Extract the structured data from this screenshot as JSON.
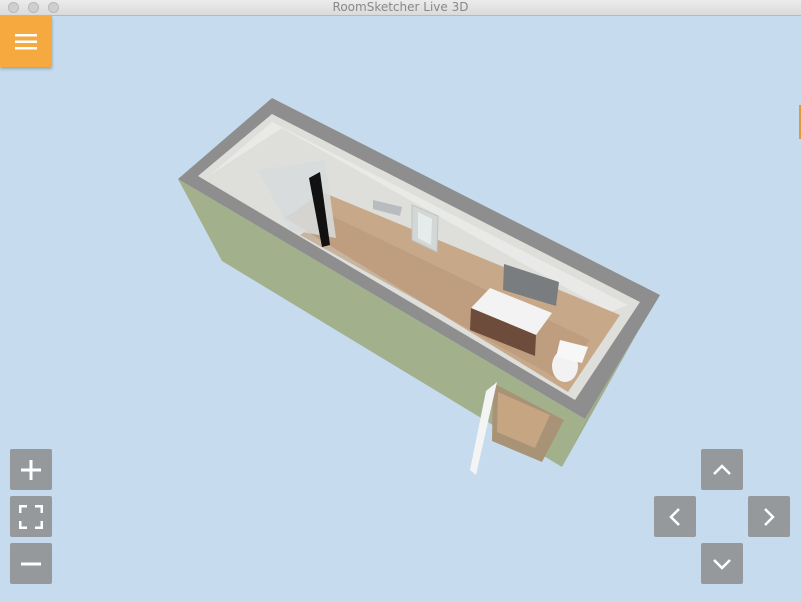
{
  "window": {
    "title": "RoomSketcher Live 3D"
  },
  "toolbar": {
    "menu_icon": "hamburger-menu-icon"
  },
  "zoom_controls": {
    "zoom_in_icon": "plus-icon",
    "fit_icon": "fullscreen-icon",
    "zoom_out_icon": "minus-icon"
  },
  "navigation": {
    "up_icon": "chevron-up-icon",
    "left_icon": "chevron-left-icon",
    "right_icon": "chevron-right-icon",
    "down_icon": "chevron-down-icon"
  },
  "colors": {
    "menu_button": "#f5a93e",
    "control_button": "#96999c",
    "background": "#c6dcee"
  }
}
